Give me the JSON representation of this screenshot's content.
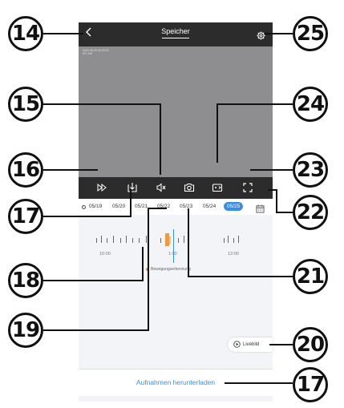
{
  "app": {
    "title": "Speicher",
    "video_timestamp_line1": "2020-05-25   06:20:15",
    "video_timestamp_line2": "IPC.HM"
  },
  "dates": [
    "05/19",
    "05/20",
    "05/21",
    "05/22",
    "05/23",
    "05/24",
    "05/25"
  ],
  "selected_date": "05/25",
  "timeline": {
    "tick_labels": [
      "10:00",
      "1:00",
      "12:00"
    ],
    "legend": "Bewegungserkennung"
  },
  "live_button": "Livebild",
  "download_link": "Aufnahmen herunterladen",
  "callouts": {
    "c14": "14",
    "c15": "15",
    "c16": "16",
    "c17a": "17",
    "c18": "18",
    "c19": "19",
    "c20": "20",
    "c21": "21",
    "c22": "22",
    "c23": "23",
    "c24": "24",
    "c25": "25",
    "c17b": "17"
  },
  "icons": {
    "back": "chevron-left-icon",
    "settings": "gear-icon",
    "playback_speed": "fast-forward-icon",
    "download": "download-icon",
    "mute": "speaker-mute-icon",
    "snapshot": "camera-icon",
    "record": "video-record-icon",
    "fullscreen": "fullscreen-icon",
    "calendar": "calendar-icon",
    "live": "play-circle-icon"
  },
  "colors": {
    "accent": "#3a8ee6",
    "motion": "#e79a4a",
    "toolbar": "#2c2c2c"
  }
}
